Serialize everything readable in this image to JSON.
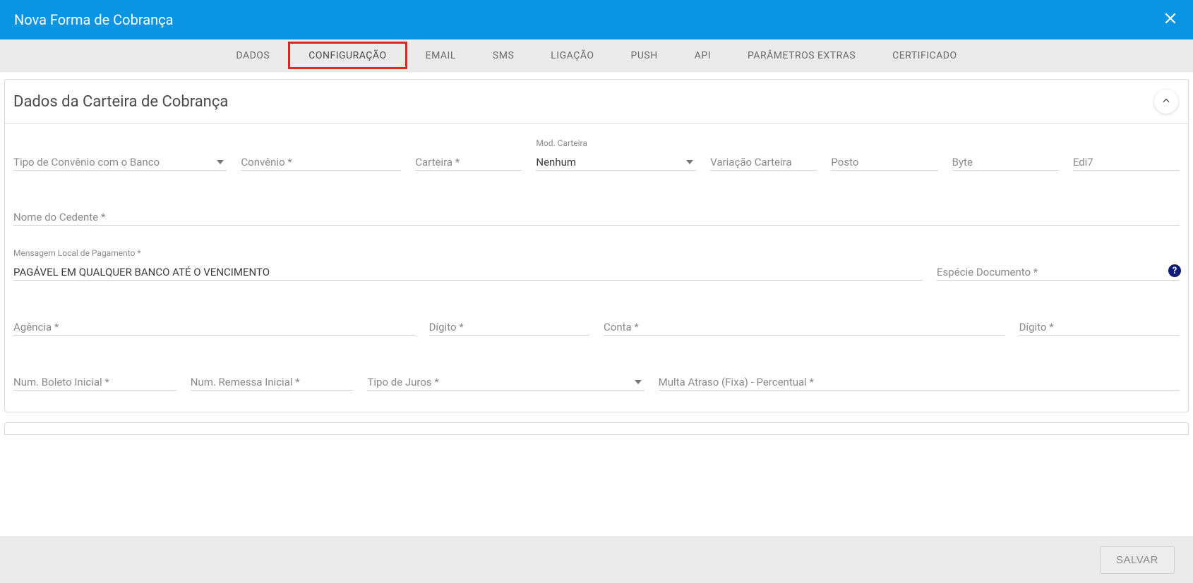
{
  "header": {
    "title": "Nova Forma de Cobrança"
  },
  "tabs": {
    "items": [
      {
        "label": "DADOS"
      },
      {
        "label": "CONFIGURAÇÃO"
      },
      {
        "label": "EMAIL"
      },
      {
        "label": "SMS"
      },
      {
        "label": "LIGAÇÃO"
      },
      {
        "label": "PUSH"
      },
      {
        "label": "API"
      },
      {
        "label": "PARÂMETROS EXTRAS"
      },
      {
        "label": "CERTIFICADO"
      }
    ],
    "active_index": 1
  },
  "panel": {
    "title": "Dados da Carteira de Cobrança"
  },
  "fields": {
    "tipo_convenio_label": "Tipo de Convênio com o Banco",
    "convenio_label": "Convênio *",
    "carteira_label": "Carteira *",
    "mod_carteira_label": "Mod. Carteira",
    "mod_carteira_value": "Nenhum",
    "variacao_label": "Variação Carteira",
    "posto_label": "Posto",
    "byte_label": "Byte",
    "edi7_label": "Edi7",
    "nome_cedente_label": "Nome do Cedente *",
    "msg_local_label": "Mensagem Local de Pagamento *",
    "msg_local_value": "PAGÁVEL EM QUALQUER BANCO ATÉ O VENCIMENTO",
    "especie_doc_label": "Espécie Documento *",
    "help_symbol": "?",
    "agencia_label": "Agência *",
    "digito1_label": "Dígito *",
    "conta_label": "Conta *",
    "digito2_label": "Dígito *",
    "num_boleto_label": "Num. Boleto Inicial *",
    "num_remessa_label": "Num. Remessa Inicial *",
    "tipo_juros_label": "Tipo de Juros *",
    "multa_atraso_label": "Multa Atraso (Fixa) - Percentual *"
  },
  "footer": {
    "save_label": "SALVAR"
  }
}
